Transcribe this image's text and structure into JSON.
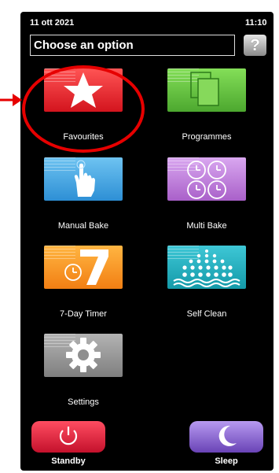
{
  "status": {
    "date": "11 ott 2021",
    "time": "11:10"
  },
  "header": {
    "title": "Choose an option",
    "help": "?"
  },
  "menu": {
    "favourites": "Favourites",
    "programmes": "Programmes",
    "manual_bake": "Manual Bake",
    "multi_bake": "Multi Bake",
    "seven_day_timer": "7-Day Timer",
    "self_clean": "Self Clean",
    "settings": "Settings"
  },
  "bottom": {
    "standby": "Standby",
    "sleep": "Sleep"
  },
  "annotation": {
    "ring_color": "#e60000"
  },
  "icons": {
    "favourites": "star-icon",
    "programmes": "documents-icon",
    "manual_bake": "hand-pointer-icon",
    "multi_bake": "clocks-icon",
    "seven_day_timer": "clock-seven-icon",
    "self_clean": "steam-dots-icon",
    "settings": "gear-icon",
    "standby": "power-icon",
    "sleep": "moon-icon"
  }
}
